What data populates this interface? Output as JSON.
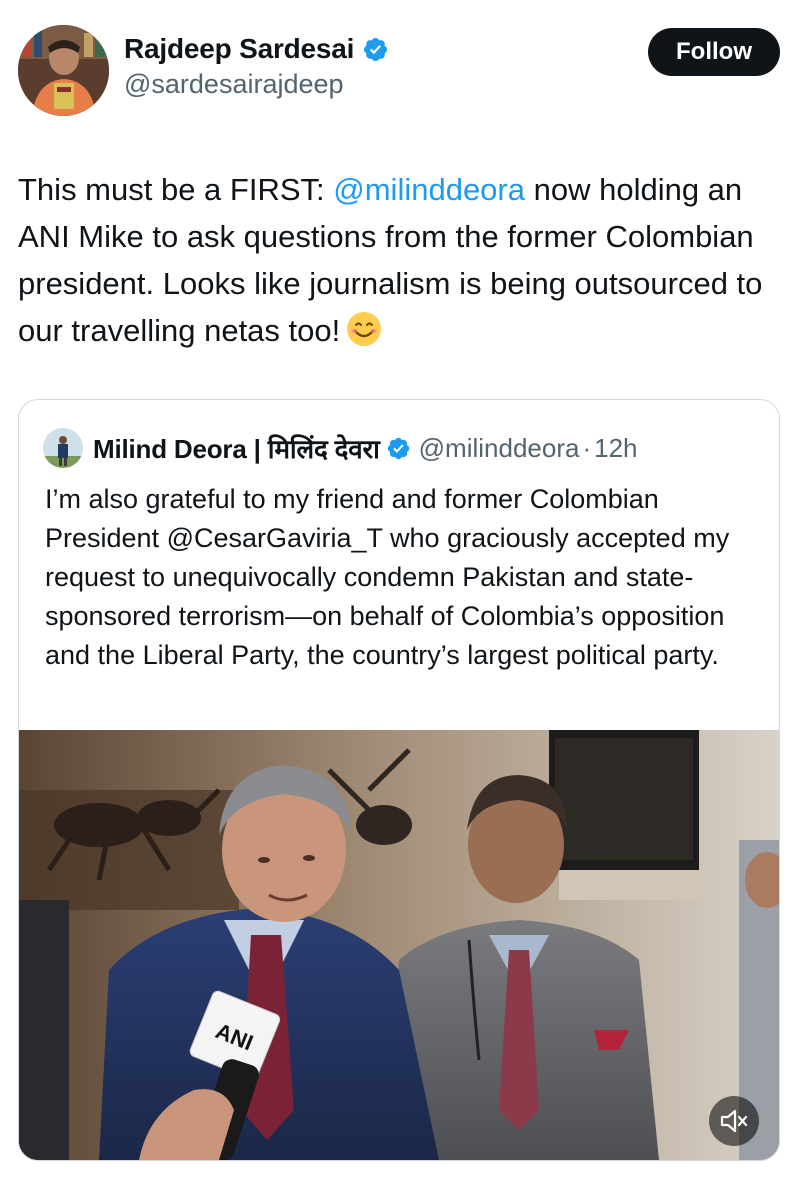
{
  "author": {
    "display_name": "Rajdeep Sardesai",
    "handle": "@sardesairajdeep",
    "verified_icon": "verified-badge-icon",
    "avatar": "profile-avatar"
  },
  "follow_button": {
    "label": "Follow"
  },
  "tweet": {
    "text_1": "This must be a FIRST: ",
    "mention": "@milinddeora",
    "text_2": " now holding an ANI Mike to ask questions from the former Colombian president. Looks like journalism is being outsourced to our travelling netas too!",
    "emoji": "smiling-face-icon"
  },
  "quoted_tweet": {
    "display_name": "Milind Deora | मिलिंद देवरा",
    "handle": "@milinddeora",
    "separator": "·",
    "time": "12h",
    "text": "I’m also grateful to my friend and former Colombian President @CesarGaviria_T who graciously accepted my request to unequivocally condemn Pakistan and state-sponsored terrorism—on behalf of Colombia’s opposition and the Liberal Party, the country’s largest political party.",
    "media": {
      "type": "video",
      "mic_logo_text": "ANI",
      "mute_icon": "speaker-muted-icon"
    }
  },
  "colors": {
    "link": "#1d9bf0",
    "verified": "#1d9bf0",
    "text": "#0f1419",
    "secondary_text": "#536471",
    "border": "#cfd9de",
    "button_bg": "#0f1419"
  }
}
